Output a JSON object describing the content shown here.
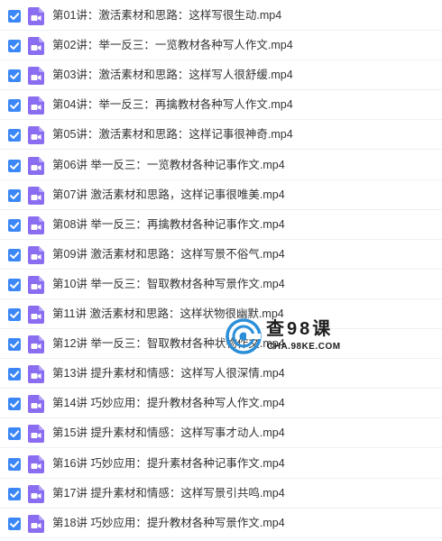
{
  "colors": {
    "checkbox": "#3c87f7",
    "video_icon": "#8a6df0",
    "row_divider": "#eef0f4",
    "text": "#333333",
    "watermark_accent": "#2b8fd8"
  },
  "icons": {
    "checkbox": "checkmark-icon",
    "file": "video-file-icon",
    "watermark": "cha98ke-logo-icon"
  },
  "files": [
    {
      "name": "第01讲：激活素材和思路：这样写很生动.mp4",
      "checked": true
    },
    {
      "name": "第02讲：举一反三：一览教材各种写人作文.mp4",
      "checked": true
    },
    {
      "name": "第03讲：激活素材和思路：这样写人很舒缓.mp4",
      "checked": true
    },
    {
      "name": "第04讲：举一反三：再擒教材各种写人作文.mp4",
      "checked": true
    },
    {
      "name": "第05讲：激活素材和思路：这样记事很神奇.mp4",
      "checked": true
    },
    {
      "name": "第06讲 举一反三：一览教材各种记事作文.mp4",
      "checked": true
    },
    {
      "name": "第07讲 激活素材和思路，这样记事很唯美.mp4",
      "checked": true
    },
    {
      "name": "第08讲 举一反三：再擒教材各种记事作文.mp4",
      "checked": true
    },
    {
      "name": "第09讲 激活素材和思路：这样写景不俗气.mp4",
      "checked": true
    },
    {
      "name": "第10讲 举一反三：智取教材各种写景作文.mp4",
      "checked": true
    },
    {
      "name": "第11讲 激活素材和思路：这样状物很幽默.mp4",
      "checked": true
    },
    {
      "name": "第12讲 举一反三：智取教材各种状物作文.mp4",
      "checked": true
    },
    {
      "name": "第13讲 提升素材和情感：这样写人很深情.mp4",
      "checked": true
    },
    {
      "name": "第14讲 巧妙应用：提升教材各种写人作文.mp4",
      "checked": true
    },
    {
      "name": "第15讲 提升素材和情感：这样写事才动人.mp4",
      "checked": true
    },
    {
      "name": "第16讲 巧妙应用：提升素材各种记事作文.mp4",
      "checked": true
    },
    {
      "name": "第17讲 提升素材和情感：这样写景引共鸣.mp4",
      "checked": true
    },
    {
      "name": "第18讲 巧妙应用：提升教材各种写景作文.mp4",
      "checked": true
    }
  ],
  "watermark": {
    "title": "查98课",
    "url": "CHA.98KE.COM"
  }
}
